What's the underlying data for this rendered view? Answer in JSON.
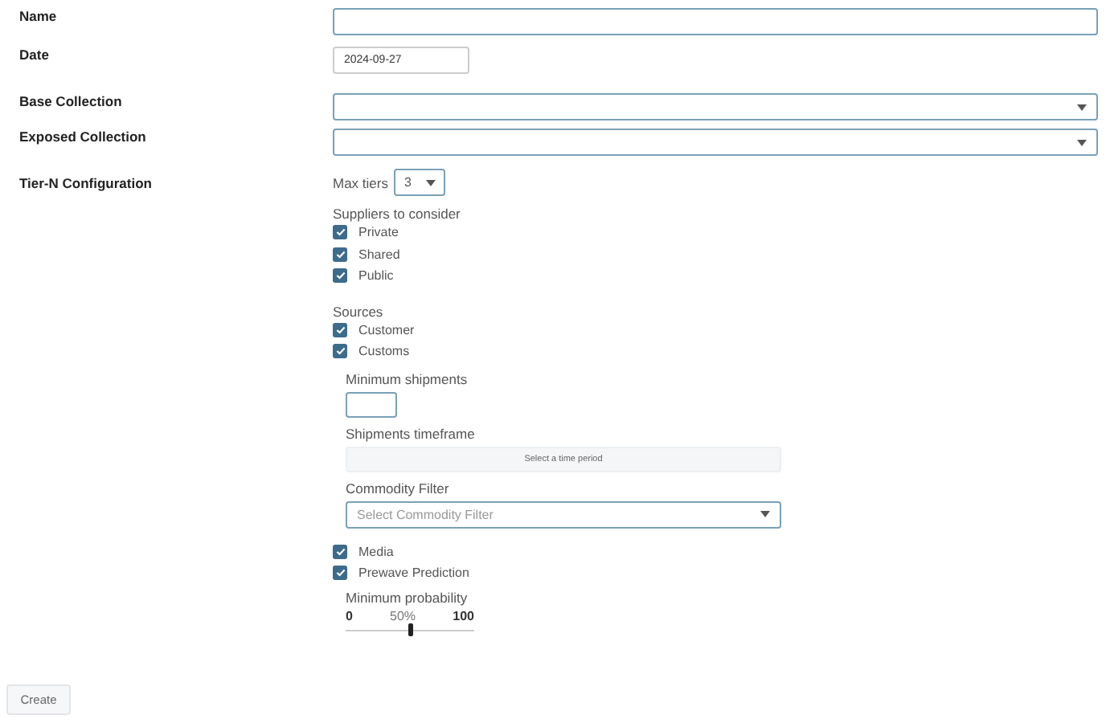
{
  "fields": [
    {
      "label": "Name",
      "kind": "text"
    },
    {
      "label": "Date",
      "kind": "date",
      "value": "2024-09-27"
    },
    {
      "label": "Base Collection",
      "kind": "select"
    },
    {
      "label": "Exposed Collection",
      "kind": "select"
    }
  ],
  "tier_config": {
    "label": "Tier-N Configuration",
    "max_tiers": {
      "label": "Max tiers",
      "value": "3"
    },
    "suppliers": {
      "label": "Suppliers to consider",
      "options": [
        {
          "label": "Private",
          "checked": true
        },
        {
          "label": "Shared",
          "checked": true
        },
        {
          "label": "Public",
          "checked": true
        }
      ]
    },
    "sources": {
      "label": "Sources",
      "options": [
        {
          "label": "Customer",
          "checked": true,
          "kind": "customs_details"
        },
        {
          "label": "Customs",
          "checked": true,
          "kind": "details"
        },
        {
          "label": "Media",
          "checked": true,
          "kind": "plain"
        },
        {
          "label": "Prewave Prediction",
          "checked": true,
          "kind": "probability"
        }
      ]
    },
    "minimum_shipments": {
      "label": "Minimum shipments"
    },
    "shipments_timeframe": {
      "label": "Shipments timeframe",
      "placeholder": "Select a time period"
    },
    "commodity_filter": {
      "label": "Commodity Filter",
      "placeholder": "Select Commodity Filter"
    },
    "minimum_probability": {
      "label": "Minimum probability",
      "min": "0",
      "max": "100",
      "reading": "50%",
      "level": 0.5
    }
  },
  "create_button": "Create"
}
